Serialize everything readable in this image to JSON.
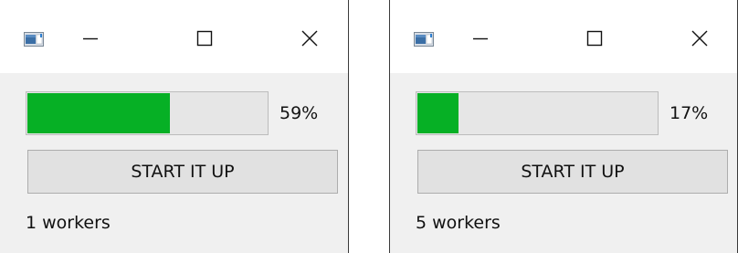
{
  "colors": {
    "progress_fill": "#06b025",
    "progress_track": "#e6e6e6",
    "window_bg": "#f0f0f0",
    "titlebar_bg": "#ffffff"
  },
  "windows": [
    {
      "icons": [
        "app-window-icon",
        "minimize-icon",
        "maximize-icon",
        "close-icon"
      ],
      "progress": {
        "value": 0.59,
        "text": "59%"
      },
      "start_button_label": "START IT UP",
      "status": "1 workers"
    },
    {
      "icons": [
        "app-window-icon",
        "minimize-icon",
        "maximize-icon",
        "close-icon"
      ],
      "progress": {
        "value": 0.17,
        "text": "17%"
      },
      "start_button_label": "START IT UP",
      "status": "5 workers"
    }
  ]
}
